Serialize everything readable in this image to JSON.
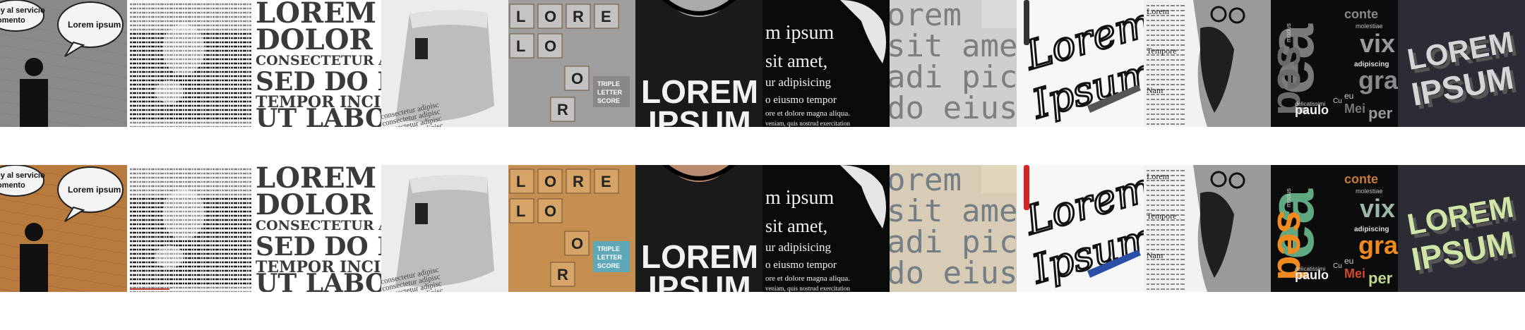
{
  "rows": [
    {
      "variant": "grayscale"
    },
    {
      "variant": "color"
    }
  ],
  "tiles": {
    "speech": {
      "bubble_left": "oy al servicio\nomento",
      "bubble_right": "Lorem ipsum"
    },
    "block": {
      "lines": [
        "LOREM",
        "DOLOR",
        "CONSECTETUR ADIP",
        "SED DO E",
        "TEMPOR INCID",
        "UT LABOR"
      ]
    },
    "cuff": {
      "text": "consectetur adipisc"
    },
    "scrabble": {
      "row1": [
        "L",
        "O",
        "R",
        "E"
      ],
      "row2": [
        "L",
        "O"
      ],
      "bonus": "TRIPLE\nLETTER\nSCORE",
      "row3": [
        "O"
      ],
      "row4": [
        "R"
      ]
    },
    "tshirt": {
      "line1": "LOREM",
      "line2": "IPSUM"
    },
    "sticker": {
      "lines": [
        "m ipsum",
        "sit amet,",
        "ur adipisicing",
        "o eiusmo tempor",
        "ore et dolore magna aliqua.",
        "veniam, quis nostrud exercitation"
      ]
    },
    "typewriter": {
      "lines": [
        "orem",
        "sit amet",
        "adi pici",
        "do eius"
      ]
    },
    "script": {
      "word1": "Lorem",
      "word2": "Ipsum"
    },
    "news": {
      "lines": [
        "Lorem",
        "Tempore",
        "Nam"
      ]
    },
    "poster": {
      "words": [
        "ea",
        "sed",
        "conte",
        "molestiae",
        "vix",
        "adipiscing",
        "gra",
        "eu",
        "paulo",
        "Mei",
        "per",
        "Cu",
        "delicatissimi",
        "modus"
      ]
    },
    "logo3d": {
      "line1": "LOREM",
      "line2": "IPSUM"
    }
  },
  "colors": {
    "wood": "#b97a3e",
    "wood_gray": "#8a8a8a",
    "tile_wood": "#d6a466",
    "tile_gray": "#c3c3c3",
    "poster_green": "#5fa882",
    "poster_orange": "#f08b1f",
    "poster_red": "#d2482c",
    "logo_green": "#cfe6a6",
    "pen_red": "#d22424",
    "pen_blue": "#2c4ea6"
  }
}
